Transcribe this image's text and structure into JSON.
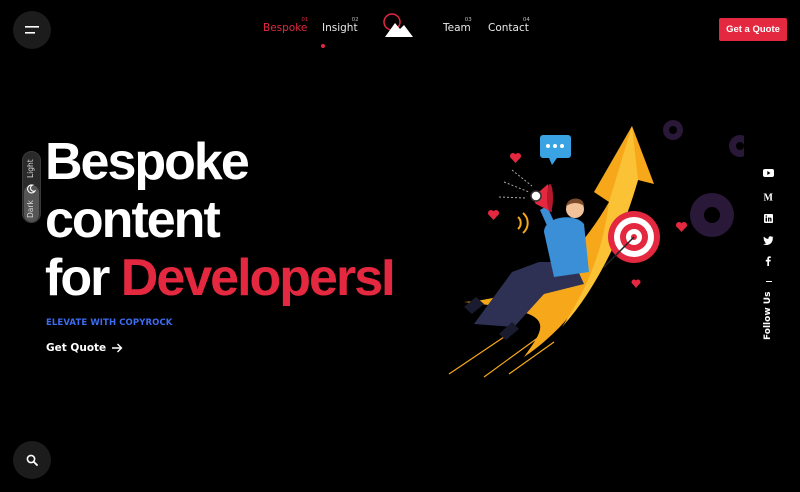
{
  "nav": {
    "items": [
      {
        "label": "Bespoke",
        "num": "01",
        "active": true
      },
      {
        "label": "Insight",
        "num": "02",
        "active": false
      },
      {
        "label": "Team",
        "num": "03",
        "active": false
      },
      {
        "label": "Contact",
        "num": "04",
        "active": false
      }
    ],
    "cta_label": "Get a Quote"
  },
  "theme": {
    "light_label": "Light",
    "dark_label": "Dark",
    "current": "dark"
  },
  "hero": {
    "title_line1": "Bespoke",
    "title_line2": "content",
    "title_line3_prefix": "for ",
    "title_line3_accent": "DevelopersI",
    "subtitle": "ELEVATE WITH COPYROCK",
    "link_label": "Get Quote"
  },
  "social": {
    "icons": [
      "youtube-icon",
      "medium-icon",
      "linkedin-icon",
      "twitter-icon",
      "facebook-icon"
    ],
    "follow_label": "Follow Us"
  },
  "colors": {
    "accent": "#e3283f",
    "subtitle_blue": "#3d6cf0",
    "background": "#000000"
  }
}
